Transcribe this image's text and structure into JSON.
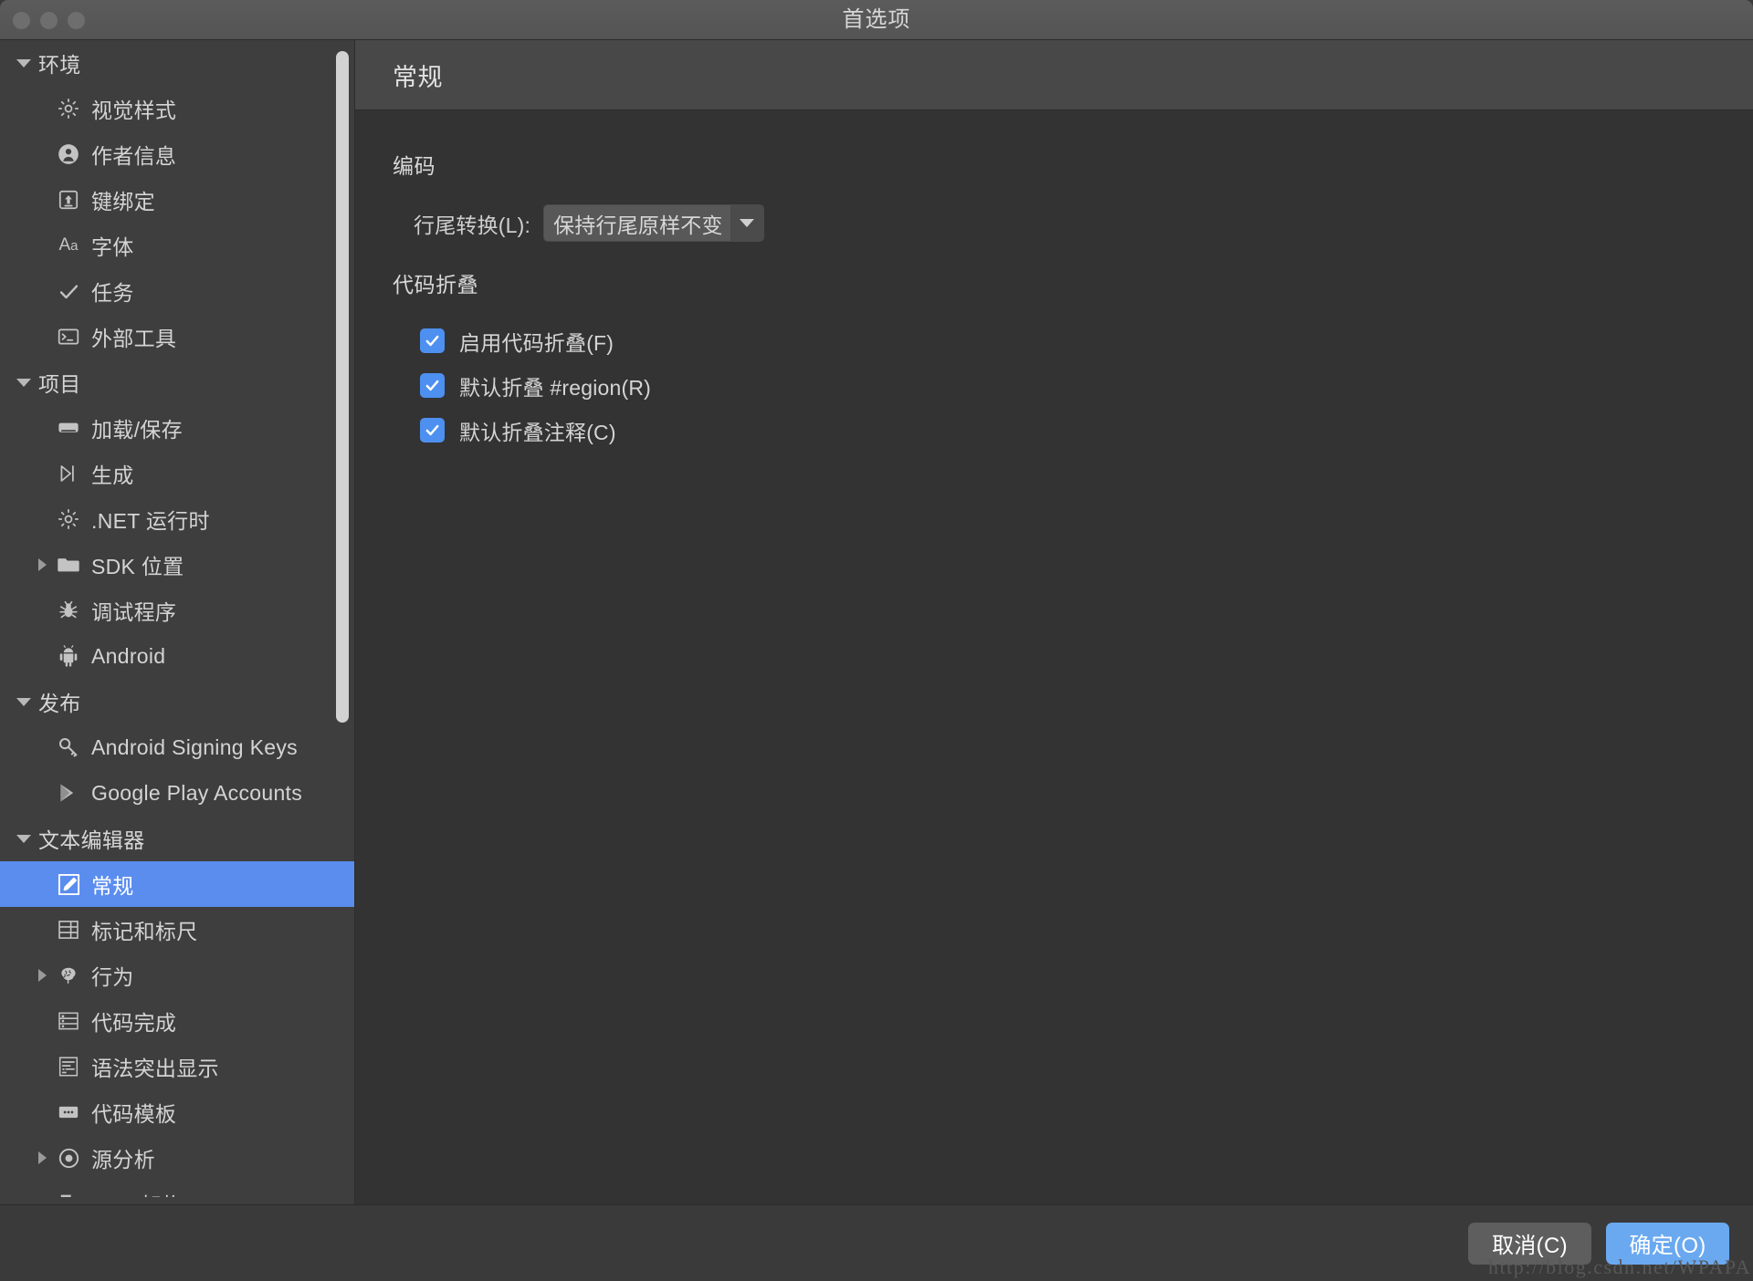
{
  "window": {
    "title": "首选项",
    "traffic_lights": [
      "close",
      "minimize",
      "maximize"
    ]
  },
  "sidebar": {
    "items": [
      {
        "label": "环境",
        "type": "group",
        "icon": "none",
        "twisty": "down",
        "selected": false
      },
      {
        "label": "视觉样式",
        "type": "leaf",
        "icon": "gear-icon",
        "twisty": "none",
        "selected": false
      },
      {
        "label": "作者信息",
        "type": "leaf",
        "icon": "person-icon",
        "twisty": "none",
        "selected": false
      },
      {
        "label": "键绑定",
        "type": "leaf",
        "icon": "keybinding-icon",
        "twisty": "none",
        "selected": false
      },
      {
        "label": "字体",
        "type": "leaf",
        "icon": "font-aa-icon",
        "twisty": "none",
        "selected": false
      },
      {
        "label": "任务",
        "type": "leaf",
        "icon": "check-icon",
        "twisty": "none",
        "selected": false
      },
      {
        "label": "外部工具",
        "type": "leaf",
        "icon": "terminal-icon",
        "twisty": "none",
        "selected": false
      },
      {
        "label": "项目",
        "type": "group",
        "icon": "none",
        "twisty": "down",
        "selected": false
      },
      {
        "label": "加载/保存",
        "type": "leaf",
        "icon": "disk-icon",
        "twisty": "none",
        "selected": false
      },
      {
        "label": "生成",
        "type": "leaf",
        "icon": "build-play-icon",
        "twisty": "none",
        "selected": false
      },
      {
        "label": ".NET 运行时",
        "type": "leaf",
        "icon": "gear-icon",
        "twisty": "none",
        "selected": false
      },
      {
        "label": "SDK 位置",
        "type": "leaf",
        "icon": "folder-icon",
        "twisty": "right",
        "selected": false
      },
      {
        "label": "调试程序",
        "type": "leaf",
        "icon": "bug-icon",
        "twisty": "none",
        "selected": false
      },
      {
        "label": "Android",
        "type": "leaf",
        "icon": "android-icon",
        "twisty": "none",
        "selected": false
      },
      {
        "label": "发布",
        "type": "group",
        "icon": "none",
        "twisty": "down",
        "selected": false
      },
      {
        "label": "Android Signing Keys",
        "type": "leaf",
        "icon": "key-icon",
        "twisty": "none",
        "selected": false
      },
      {
        "label": "Google Play Accounts",
        "type": "leaf",
        "icon": "google-play-icon",
        "twisty": "none",
        "selected": false
      },
      {
        "label": "文本编辑器",
        "type": "group",
        "icon": "none",
        "twisty": "down",
        "selected": false
      },
      {
        "label": "常规",
        "type": "leaf",
        "icon": "pencil-edit-icon",
        "twisty": "none",
        "selected": true
      },
      {
        "label": "标记和标尺",
        "type": "leaf",
        "icon": "margins-rulers-icon",
        "twisty": "none",
        "selected": false
      },
      {
        "label": "行为",
        "type": "leaf",
        "icon": "brain-icon",
        "twisty": "right",
        "selected": false
      },
      {
        "label": "代码完成",
        "type": "leaf",
        "icon": "code-completion-icon",
        "twisty": "none",
        "selected": false
      },
      {
        "label": "语法突出显示",
        "type": "leaf",
        "icon": "syntax-highlight-icon",
        "twisty": "none",
        "selected": false
      },
      {
        "label": "代码模板",
        "type": "leaf",
        "icon": "code-template-icon",
        "twisty": "none",
        "selected": false
      },
      {
        "label": "源分析",
        "type": "leaf",
        "icon": "source-analysis-icon",
        "twisty": "right",
        "selected": false
      },
      {
        "label": "XML 架构",
        "type": "leaf",
        "icon": "xml-schema-icon",
        "twisty": "none",
        "selected": false
      }
    ],
    "scrollbar": {
      "visible": true
    }
  },
  "content": {
    "header_title": "常规",
    "sections": [
      {
        "title": "编码",
        "field": {
          "label": "行尾转换(L):",
          "value": "保持行尾原样不变",
          "arrow": "chevron-down-icon"
        }
      },
      {
        "title": "代码折叠",
        "checkboxes": [
          {
            "label": "启用代码折叠(F)",
            "checked": true
          },
          {
            "label": "默认折叠 #region(R)",
            "checked": true
          },
          {
            "label": "默认折叠注释(C)",
            "checked": true
          }
        ]
      }
    ]
  },
  "footer": {
    "cancel_label": "取消(C)",
    "ok_label": "确定(O)"
  },
  "watermark": "http://blog.csdn.net/WPAPA",
  "colors": {
    "accent": "#5b8def",
    "checkbox": "#4d90f0",
    "primary_button": "#6aa9f0",
    "sidebar_bg": "#3e3e3e",
    "content_bg": "#333333",
    "header_bg": "#484848"
  }
}
